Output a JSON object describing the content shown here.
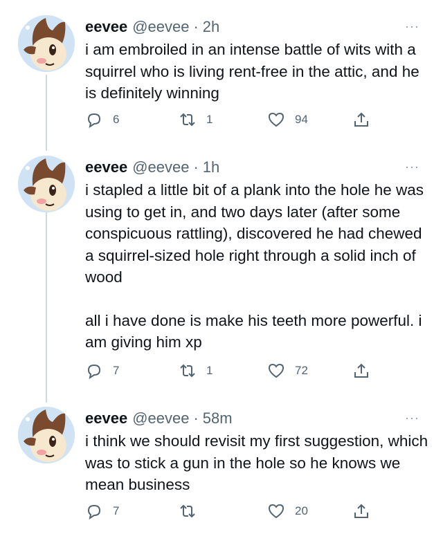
{
  "tweets": [
    {
      "name": "eevee",
      "handle": "@eevee",
      "separator": "·",
      "time": "2h",
      "more": "···",
      "paragraphs": [
        "i am embroiled in an intense battle of wits with a squirrel who is living rent-free in the attic, and he is definitely winning"
      ],
      "replies": "6",
      "retweets": "1",
      "likes": "94"
    },
    {
      "name": "eevee",
      "handle": "@eevee",
      "separator": "·",
      "time": "1h",
      "more": "···",
      "paragraphs": [
        "i stapled a little bit of a plank into the hole he was using to get in, and two days later (after some conspicuous rattling), discovered he had chewed a squirrel-sized hole right through a solid inch of wood",
        "all i have done is make his teeth more powerful.  i am giving him xp"
      ],
      "replies": "7",
      "retweets": "1",
      "likes": "72"
    },
    {
      "name": "eevee",
      "handle": "@eevee",
      "separator": "·",
      "time": "58m",
      "more": "···",
      "paragraphs": [
        "i think we should revisit my first suggestion, which was to stick a gun in the hole so he knows we mean business"
      ],
      "replies": "7",
      "retweets": "",
      "likes": "20"
    }
  ],
  "icons": {
    "reply": "reply-icon",
    "retweet": "retweet-icon",
    "like": "like-icon",
    "share": "share-icon",
    "more": "more-icon"
  },
  "colors": {
    "text": "#0f1419",
    "muted": "#536471",
    "thread_line": "#cfd9de",
    "avatar_bg": "#cfe3f5",
    "fur_brown": "#7a4a2e",
    "fur_cream": "#f6e7cf"
  }
}
